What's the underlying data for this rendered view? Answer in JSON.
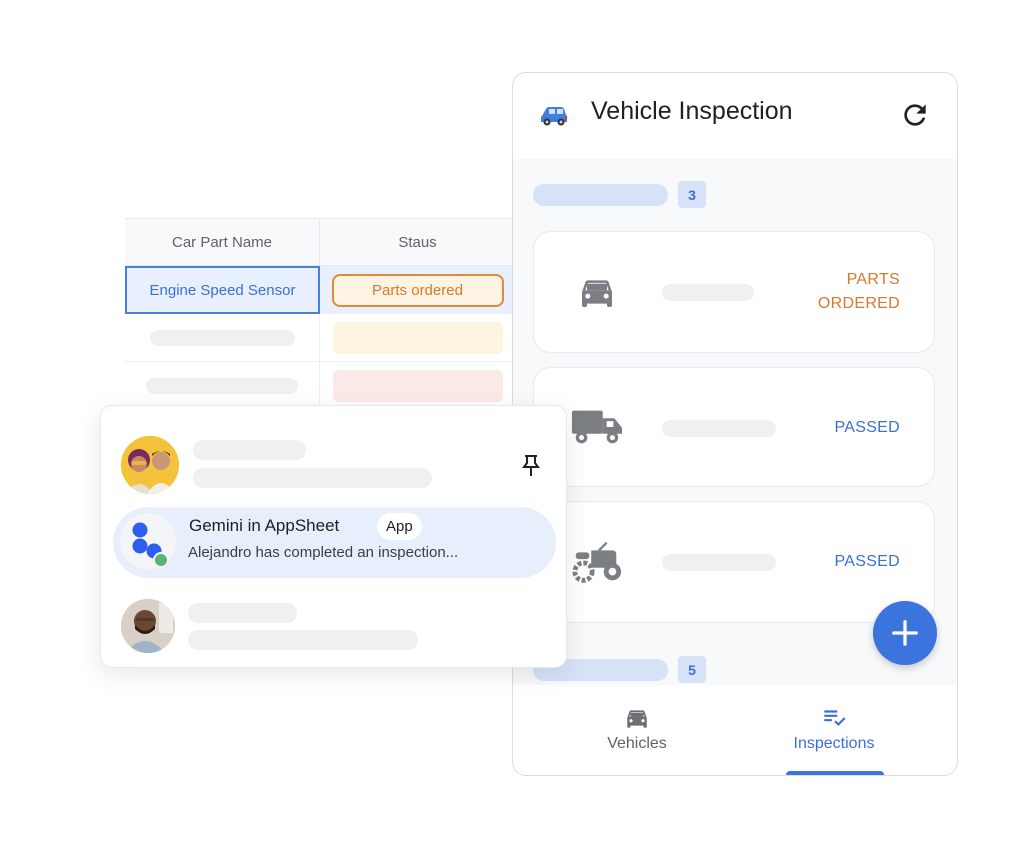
{
  "spreadsheet": {
    "columns": [
      "Car Part Name",
      "Staus"
    ],
    "rows": [
      {
        "part": "Engine Speed Sensor",
        "status": "Parts ordered"
      }
    ],
    "placeholder_rows": 2
  },
  "app": {
    "title": "Vehicle Inspection",
    "header_icon": "blue-car-icon",
    "refresh_icon": "refresh-icon",
    "groups": [
      {
        "count": "3"
      },
      {
        "count": "5"
      }
    ],
    "cards": [
      {
        "vehicle_icon": "car-icon",
        "status_line1": "PARTS",
        "status_line2": "ORDERED",
        "status_color": "#d9792a"
      },
      {
        "vehicle_icon": "truck-icon",
        "status_line1": "PASSED",
        "status_line2": "",
        "status_color": "#3b6fd8"
      },
      {
        "vehicle_icon": "tractor-icon",
        "status_line1": "PASSED",
        "status_line2": "",
        "status_color": "#3b6fd8"
      }
    ],
    "fab_icon": "plus-icon",
    "bottom_nav": [
      {
        "label": "Vehicles",
        "icon": "car-icon",
        "active": false
      },
      {
        "label": "Inspections",
        "icon": "checklist-icon",
        "active": true
      }
    ]
  },
  "chat": {
    "items": [
      {
        "avatar": "group-avatar",
        "pinned": true
      },
      {
        "sender": "Gemini in AppSheet",
        "badge": "App",
        "message": "Alejandro has completed an inspection...",
        "highlighted": true
      },
      {
        "avatar": "person-avatar"
      }
    ]
  },
  "colors": {
    "accent_blue": "#3b74dc",
    "status_orange": "#d9792a",
    "status_blue": "#3b6fd8",
    "gemini_blue": "#2d5ef0",
    "online_green": "#5bb274"
  }
}
